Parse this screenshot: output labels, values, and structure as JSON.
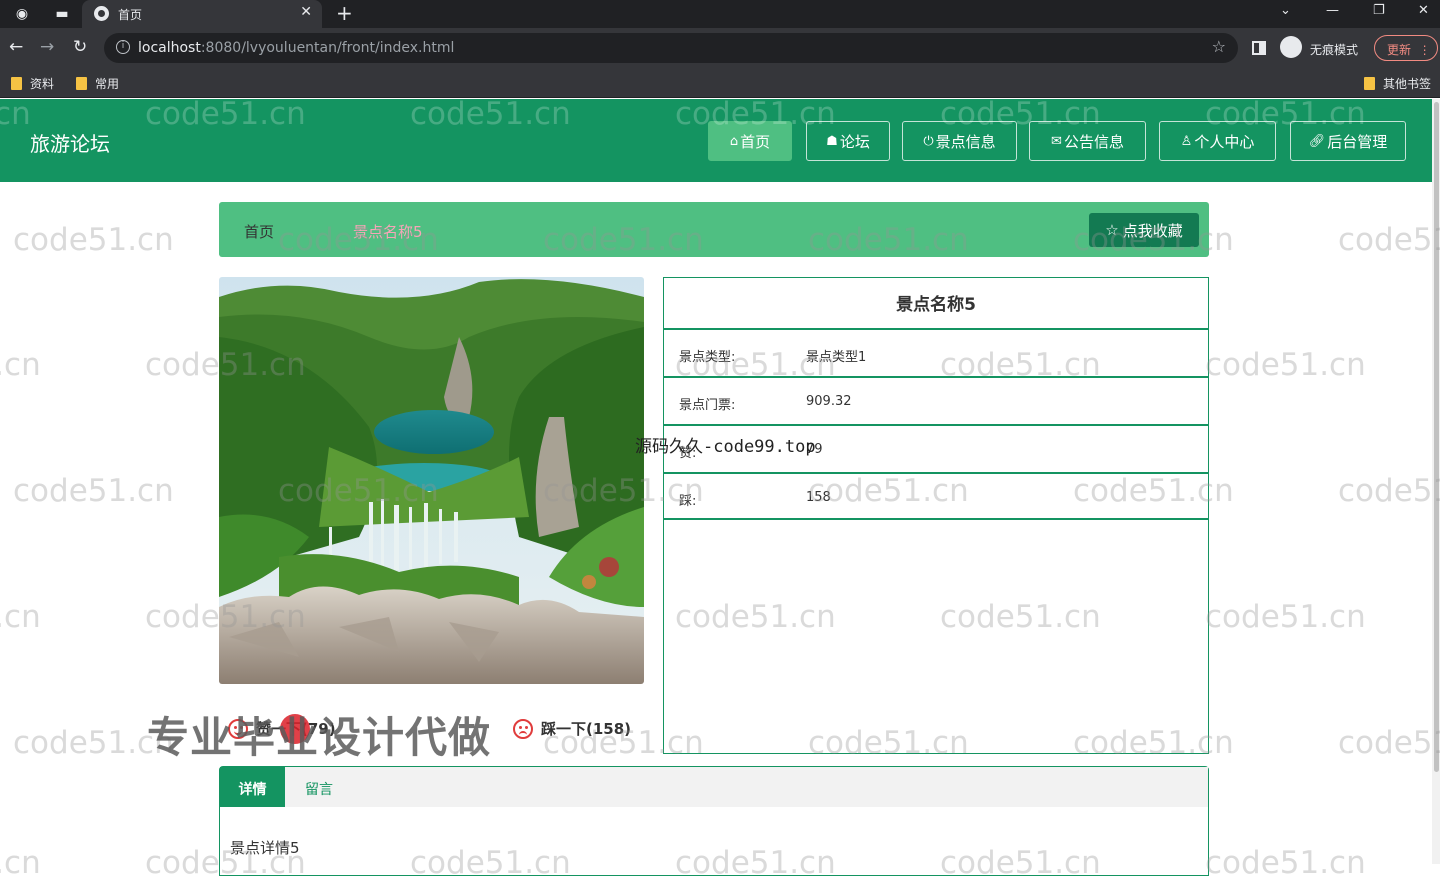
{
  "browser": {
    "tab_title": "首页",
    "url_host": "localhost",
    "url_path": ":8080/lvyouluentan/front/index.html",
    "incognito_label": "无痕模式",
    "update_label": "更新",
    "bookmarks": [
      "资料",
      "常用"
    ],
    "other_bookmarks": "其他书签"
  },
  "site": {
    "title": "旅游论坛",
    "nav": [
      {
        "label": "首页",
        "icon": "home-icon"
      },
      {
        "label": "论坛",
        "icon": "graduation-icon"
      },
      {
        "label": "景点信息",
        "icon": "power-icon"
      },
      {
        "label": "公告信息",
        "icon": "mail-icon"
      },
      {
        "label": "个人中心",
        "icon": "user-icon"
      },
      {
        "label": "后台管理",
        "icon": "link-icon"
      }
    ],
    "accent": "#149461",
    "accent_light": "#4fbf82"
  },
  "breadcrumb": {
    "home": "首页",
    "current": "景点名称5",
    "favorite_label": "点我收藏"
  },
  "detail": {
    "name": "景点名称5",
    "rows": [
      {
        "key": "景点类型:",
        "value": "景点类型1"
      },
      {
        "key": "景点门票:",
        "value": "909.32"
      },
      {
        "key": "赞:",
        "value": "79"
      },
      {
        "key": "踩:",
        "value": "158"
      }
    ],
    "like_label": "赞一下(79)",
    "dislike_label": "踩一下(158)"
  },
  "tabs": {
    "detail_label": "详情",
    "comment_label": "留言",
    "content": "景点详情5"
  },
  "watermarks": {
    "repeat": "code51.cn",
    "center": "源码久久-code99.top",
    "ad": "专业毕业设计代做"
  }
}
